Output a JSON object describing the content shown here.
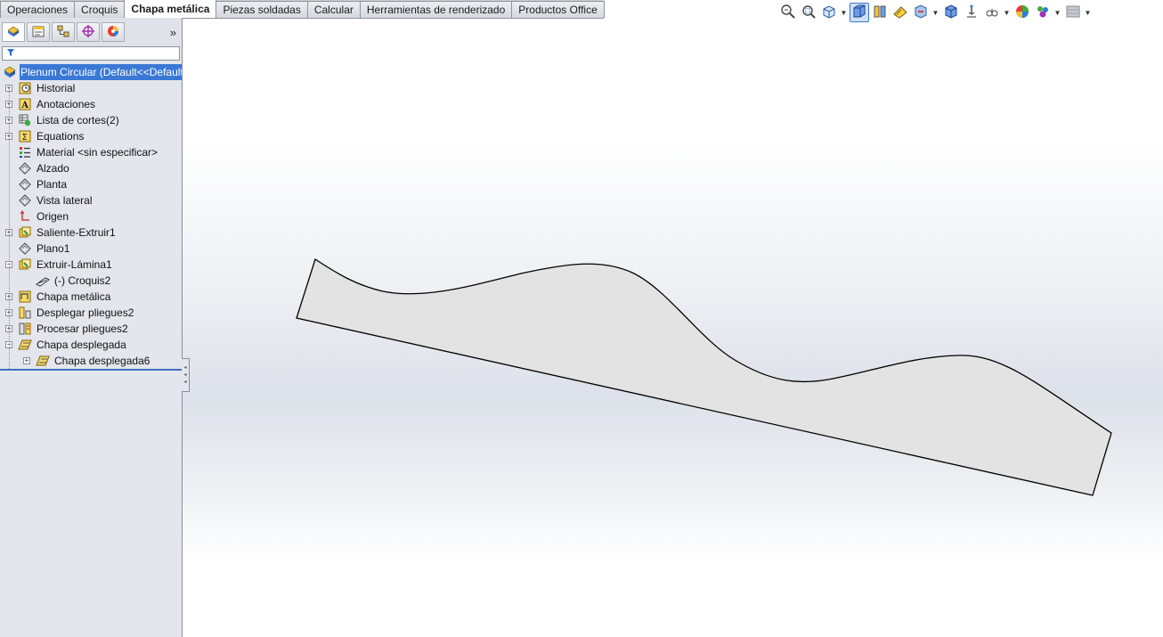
{
  "command_tabs": [
    {
      "label": "Operaciones",
      "active": false
    },
    {
      "label": "Croquis",
      "active": false
    },
    {
      "label": "Chapa metálica",
      "active": true
    },
    {
      "label": "Piezas soldadas",
      "active": false
    },
    {
      "label": "Calcular",
      "active": false
    },
    {
      "label": "Herramientas de renderizado",
      "active": false
    },
    {
      "label": "Productos Office",
      "active": false
    }
  ],
  "heads_up_toolbar": [
    {
      "icon": "zoom-to-fit-icon",
      "caret": false
    },
    {
      "icon": "zoom-to-area-icon",
      "caret": false
    },
    {
      "icon": "previous-view-icon",
      "caret": true
    },
    {
      "icon": "section-view-icon",
      "caret": false,
      "active": true
    },
    {
      "icon": "view-orientation-icon",
      "caret": false
    },
    {
      "icon": "display-style-icon",
      "caret": false
    },
    {
      "icon": "hide-show-items-icon",
      "caret": true
    },
    {
      "icon": "edit-appearance-icon",
      "caret": false
    },
    {
      "icon": "apply-scene-icon",
      "caret": false
    },
    {
      "icon": "view-settings-icon",
      "caret": true
    },
    {
      "icon": "appearance-icon",
      "caret": false
    },
    {
      "icon": "scene-icon",
      "caret": true
    },
    {
      "icon": "view-setting-icon",
      "caret": true
    }
  ],
  "pane_tabs": [
    {
      "icon": "featuremanager-icon",
      "active": true
    },
    {
      "icon": "propertymanager-icon",
      "active": false
    },
    {
      "icon": "configurationmanager-icon",
      "active": false
    },
    {
      "icon": "dimxpert-icon",
      "active": false
    },
    {
      "icon": "displaymanager-icon",
      "active": false
    }
  ],
  "pane_more": "»",
  "filter_icon": "filter-icon",
  "tree": {
    "root_label": "Plenum Circular  (Default<<Default>)",
    "items": [
      {
        "label": "Historial",
        "icon": "history-icon",
        "indent": 0,
        "expander": "+"
      },
      {
        "label": "Anotaciones",
        "icon": "annotations-icon",
        "indent": 0,
        "expander": "+"
      },
      {
        "label": "Lista de cortes(2)",
        "icon": "cut-list-icon",
        "indent": 0,
        "expander": "+"
      },
      {
        "label": "Equations",
        "icon": "equations-icon",
        "indent": 0,
        "expander": "+"
      },
      {
        "label": "Material <sin especificar>",
        "icon": "material-icon",
        "indent": 0,
        "expander": ""
      },
      {
        "label": "Alzado",
        "icon": "plane-icon",
        "indent": 0,
        "expander": ""
      },
      {
        "label": "Planta",
        "icon": "plane-icon",
        "indent": 0,
        "expander": ""
      },
      {
        "label": "Vista lateral",
        "icon": "plane-icon",
        "indent": 0,
        "expander": ""
      },
      {
        "label": "Origen",
        "icon": "origin-icon",
        "indent": 0,
        "expander": ""
      },
      {
        "label": "Saliente-Extruir1",
        "icon": "extrude-icon",
        "indent": 0,
        "expander": "+"
      },
      {
        "label": "Plano1",
        "icon": "plane-icon",
        "indent": 0,
        "expander": ""
      },
      {
        "label": "Extruir-Lámina1",
        "icon": "extrude-icon",
        "indent": 0,
        "expander": "−"
      },
      {
        "label": "(-) Croquis2",
        "icon": "sketch-icon",
        "indent": 1,
        "expander": ""
      },
      {
        "label": "Chapa metálica",
        "icon": "sheet-metal-icon",
        "indent": 0,
        "expander": "+"
      },
      {
        "label": "Desplegar pliegues2",
        "icon": "unfold-icon",
        "indent": 0,
        "expander": "+"
      },
      {
        "label": "Procesar pliegues2",
        "icon": "fold-icon",
        "indent": 0,
        "expander": "+"
      },
      {
        "label": "Chapa desplegada",
        "icon": "flat-pattern-icon",
        "indent": 0,
        "expander": "−"
      },
      {
        "label": "Chapa desplegada6",
        "icon": "flat-pattern-icon",
        "indent": 1,
        "expander": "+"
      }
    ]
  },
  "colors": {
    "selection": "#3a78d6",
    "part_fill": "#e3e3e3",
    "part_edge": "#000000"
  }
}
